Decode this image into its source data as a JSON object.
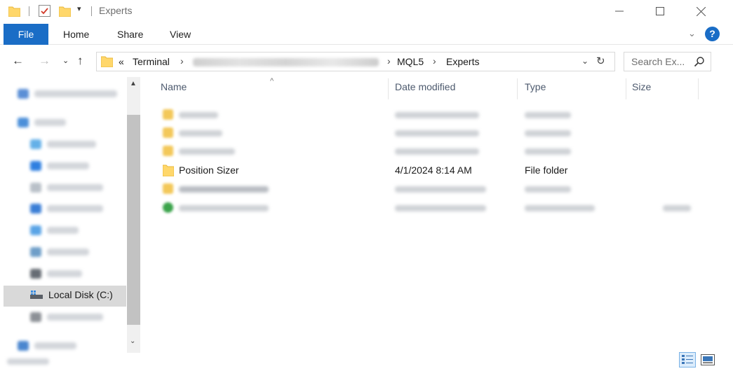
{
  "window": {
    "title": "Experts",
    "minimize_icon": "minimize-icon",
    "maximize_icon": "maximize-icon",
    "close_icon": "close-icon"
  },
  "ribbon": {
    "tabs": [
      "File",
      "Home",
      "Share",
      "View"
    ],
    "accent": "#1a6dc6",
    "help_label": "?"
  },
  "address": {
    "overflow": "«",
    "crumbs": [
      "Terminal",
      "MQL5",
      "Experts"
    ],
    "separator": "›"
  },
  "search": {
    "placeholder": "Search Ex..."
  },
  "navpane": {
    "selected_item": "Local Disk (C:)"
  },
  "columns": {
    "name": "Name",
    "date": "Date modified",
    "type": "Type",
    "size": "Size"
  },
  "files": {
    "visible_row": {
      "name": "Position Sizer",
      "date": "4/1/2024 8:14 AM",
      "type": "File folder"
    }
  },
  "colors": {
    "folder": "#ffd76b",
    "folder_dark": "#e8b83d",
    "selection": "#d9d9d9"
  }
}
